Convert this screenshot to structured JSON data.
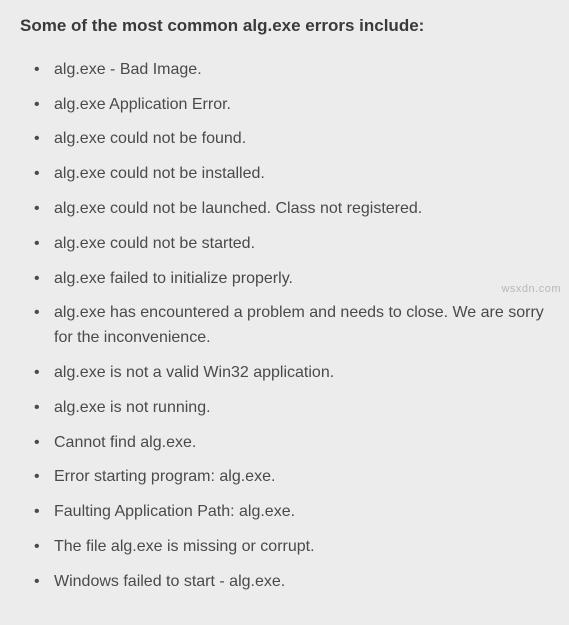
{
  "heading": "Some of the most common alg.exe errors include:",
  "errors": [
    "alg.exe - Bad Image.",
    "alg.exe Application Error.",
    "alg.exe could not be found.",
    "alg.exe could not be installed.",
    "alg.exe could not be launched. Class not registered.",
    "alg.exe could not be started.",
    "alg.exe failed to initialize properly.",
    "alg.exe has encountered a problem and needs to close. We are sorry for the inconvenience.",
    "alg.exe is not a valid Win32 application.",
    "alg.exe is not running.",
    "Cannot find alg.exe.",
    "Error starting program: alg.exe.",
    "Faulting Application Path: alg.exe.",
    "The file alg.exe is missing or corrupt.",
    "Windows failed to start - alg.exe."
  ],
  "watermark": "wsxdn.com"
}
